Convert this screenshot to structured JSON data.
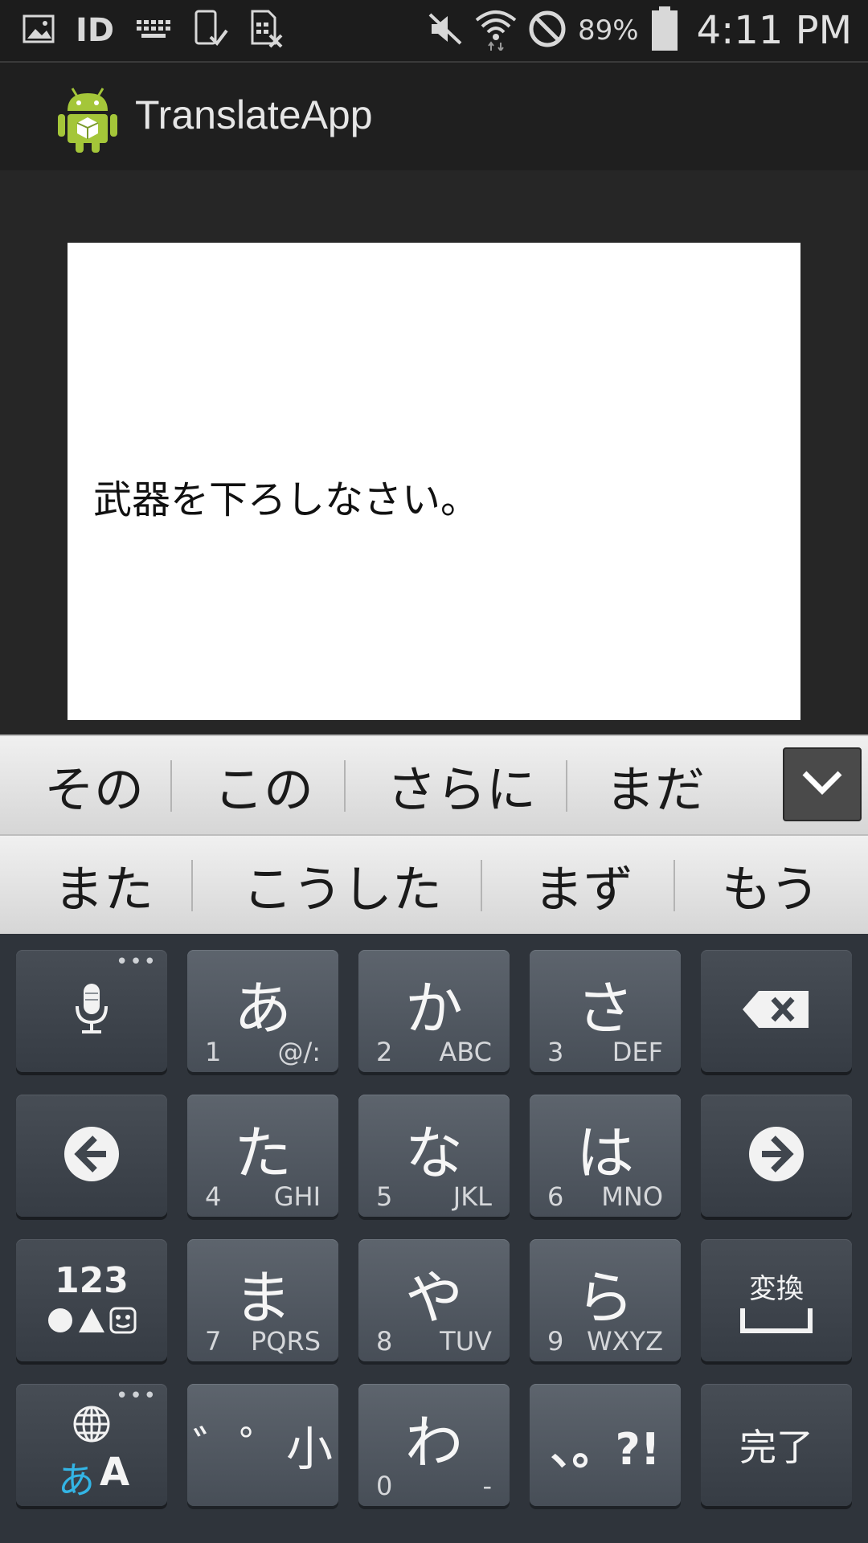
{
  "status_bar": {
    "id_label": "ID",
    "battery_percent": "89%",
    "time": "4:11 PM"
  },
  "action_bar": {
    "title": "TranslateApp"
  },
  "content": {
    "text_value": "武器を下ろしなさい。"
  },
  "candidates": {
    "row1": [
      "その",
      "この",
      "さらに",
      "まだ"
    ],
    "row2": [
      "また",
      "こうした",
      "まず",
      "もう"
    ]
  },
  "keys": {
    "a": {
      "main": "あ",
      "num": "1",
      "sub": "@/:"
    },
    "ka": {
      "main": "か",
      "num": "2",
      "sub": "ABC"
    },
    "sa": {
      "main": "さ",
      "num": "3",
      "sub": "DEF"
    },
    "ta": {
      "main": "た",
      "num": "4",
      "sub": "GHI"
    },
    "na": {
      "main": "な",
      "num": "5",
      "sub": "JKL"
    },
    "ha": {
      "main": "は",
      "num": "6",
      "sub": "MNO"
    },
    "ma": {
      "main": "ま",
      "num": "7",
      "sub": "PQRS"
    },
    "ya": {
      "main": "や",
      "num": "8",
      "sub": "TUV"
    },
    "ra": {
      "main": "ら",
      "num": "9",
      "sub": "WXYZ"
    },
    "wa": {
      "main": "わ",
      "num": "0",
      "sub": "-"
    },
    "mode_123": "123",
    "lang_a": "あ",
    "lang_A": "A",
    "dakuten": "゛゜小",
    "punct": "、。?!",
    "convert": "変換",
    "done": "完了"
  },
  "colors": {
    "accent_blue": "#33b5e5",
    "android_green": "#a4c639"
  }
}
